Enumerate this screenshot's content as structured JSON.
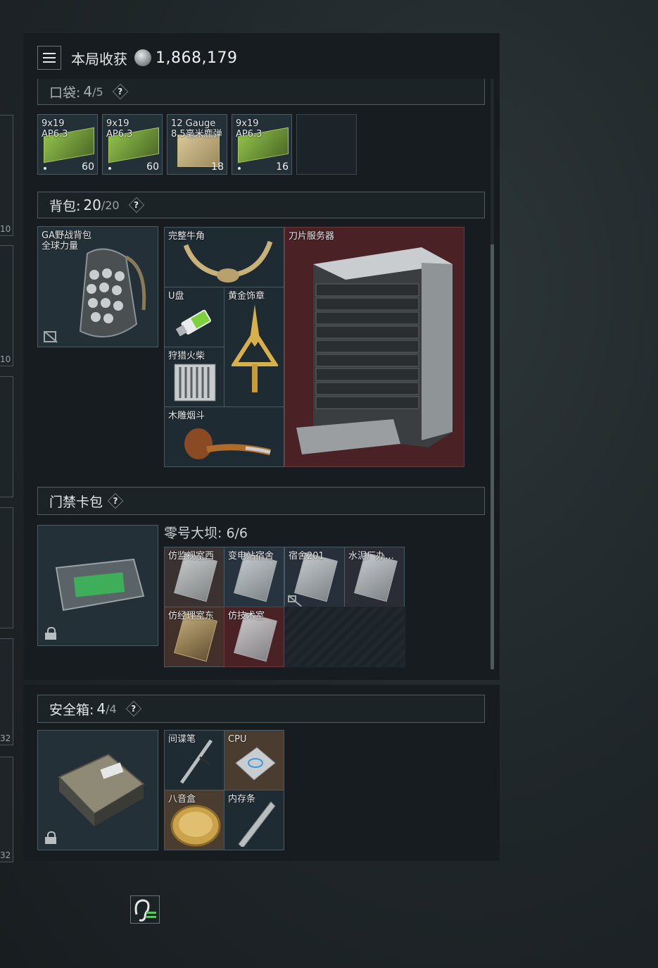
{
  "header": {
    "title": "本局收获",
    "total_value": "1,868,179",
    "menu_icon": "menu-icon",
    "coin_icon": "coin-icon"
  },
  "left_strip": [
    {
      "num": "10"
    },
    {
      "num": "10"
    },
    {
      "num": ""
    },
    {
      "num": ""
    },
    {
      "num": "32"
    },
    {
      "num": "32"
    }
  ],
  "pocket": {
    "label": "口袋:",
    "count": "4",
    "max": "/5",
    "help": "?",
    "items": [
      {
        "name": "9x19\nAP6.3",
        "qty": "60"
      },
      {
        "name": "9x19\nAP6.3",
        "qty": "60"
      },
      {
        "name": "12 Gauge\n8.5毫米鹿弹",
        "qty": "18"
      },
      {
        "name": "9x19\nAP6.3",
        "qty": "16"
      }
    ]
  },
  "backpack": {
    "label": "背包:",
    "count": "20",
    "max": "/20",
    "help": "?",
    "equipped": "GA野战背包\n全球力量",
    "items": {
      "horn": "完整牛角",
      "usb": "U盘",
      "gold_badge": "黄金饰章",
      "matches": "狩猎火柴",
      "pipe": "木雕烟斗",
      "server": "刀片服务器"
    }
  },
  "keycard": {
    "label": "门禁卡包",
    "help": "?",
    "map_title": "零号大坝: 6/6",
    "cards": [
      "仿监视室西",
      "变电站宿舍",
      "宿舍201",
      "水泥厂办…",
      "仿经理室东",
      "仿技术室"
    ]
  },
  "safebox": {
    "label": "安全箱:",
    "count": "4",
    "max": "/4",
    "help": "?",
    "items": {
      "spy_pen": "间谍笔",
      "cpu": "CPU",
      "music_box": "八音盒",
      "ram": "内存条"
    }
  },
  "colors": {
    "red_slot": "#4a2226",
    "dark_slot": "#243038",
    "panel": "#161c1f"
  }
}
